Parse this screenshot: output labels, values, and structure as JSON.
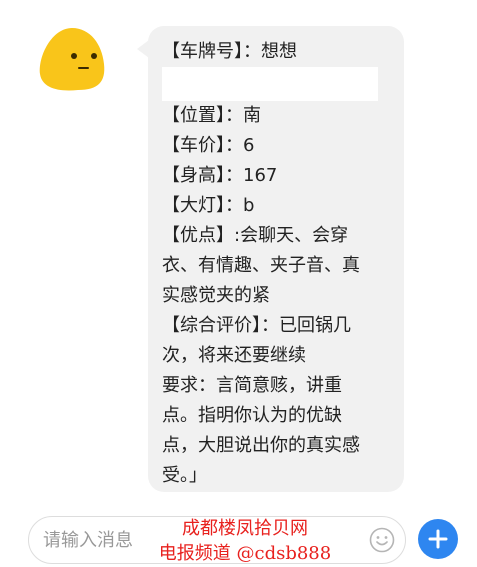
{
  "message": {
    "lines_top": [
      "【车牌号】：想想"
    ],
    "lines_main": [
      "【位置】：南",
      "【车价】：6",
      "【身高】：167",
      "【大灯】：b",
      "【优点】:会聊天、会穿",
      "衣、有情趣、夹子音、真",
      "实感觉夹的紧",
      "【综合评价】：已回锅几",
      "次，将来还要继续",
      "要求：言简意赅，讲重",
      "点。指明你认为的优缺",
      "点，大胆说出你的真实感",
      "受。」"
    ]
  },
  "input": {
    "placeholder": "请输入消息"
  },
  "watermark": {
    "line1": "成都楼凤拾贝网",
    "line2": "电报频道 @cdsb888"
  },
  "colors": {
    "bubble": "#f1f1f1",
    "avatar": "#f9c51a",
    "send_button": "#2e86f0",
    "watermark": "#e8211e"
  },
  "icons": {
    "avatar": "yellow-blob-avatar",
    "emoji": "smiley-icon",
    "send": "plus-icon"
  }
}
